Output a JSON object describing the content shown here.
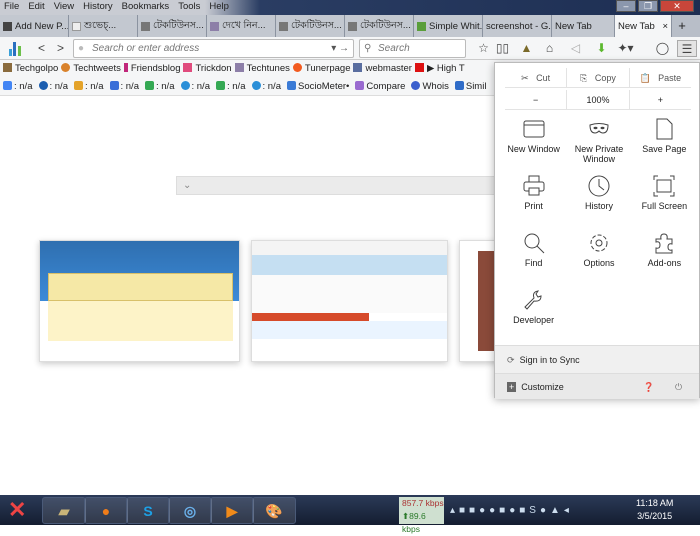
{
  "menubar": [
    "File",
    "Edit",
    "View",
    "History",
    "Bookmarks",
    "Tools",
    "Help"
  ],
  "tabs": [
    "Add New P...",
    "শুভেচ্...",
    "টেকটিউনস...",
    "দেখে নিন...",
    "টেকটিউনস...",
    "টেকটিউনস...",
    "Simple Whit...",
    "screenshot - G...",
    "New Tab",
    "New Tab"
  ],
  "nav": {
    "url_placeholder": "Search or enter address",
    "search_placeholder": "Search"
  },
  "bookmarks": [
    {
      "label": "Techgolpo",
      "color": "#8a6b3d"
    },
    {
      "label": "Techtweets",
      "color": "#d9822b"
    },
    {
      "label": "Friendsblog",
      "color": "#c0267a"
    },
    {
      "label": "Trickdon",
      "color": "#e04b7d"
    },
    {
      "label": "Techtunes",
      "color": "#8d7fa8"
    },
    {
      "label": "Tunerpage",
      "color": "#f25a1f"
    },
    {
      "label": "webmaster",
      "color": "#5a6ea0"
    },
    {
      "label": "▶ High T",
      "color": "#d11"
    }
  ],
  "addons": [
    {
      "label": ": n/a",
      "color": "#4285f4"
    },
    {
      "label": ": n/a",
      "color": "#1b5eb0"
    },
    {
      "label": ": n/a",
      "color": "#e4a32a"
    },
    {
      "label": ": n/a",
      "color": "#3a6fd8"
    },
    {
      "label": ": n/a",
      "color": "#34a853"
    },
    {
      "label": ": n/a",
      "color": "#2a8fd8"
    },
    {
      "label": ": n/a",
      "color": "#34a853"
    },
    {
      "label": ": n/a",
      "color": "#2a8fd8"
    },
    {
      "label": "SocioMeter•",
      "color": "#3b7bd6"
    },
    {
      "label": "Compare",
      "color": "#9a6bd0"
    },
    {
      "label": "Whois",
      "color": "#3a5fcd"
    },
    {
      "label": "Simil",
      "color": "#2f6cc8"
    }
  ],
  "panel": {
    "cut": "Cut",
    "copy": "Copy",
    "paste": "Paste",
    "zoom_out": "−",
    "zoom": "100%",
    "zoom_in": "+",
    "items": [
      "New Window",
      "New Private Window",
      "Save Page",
      "Print",
      "History",
      "Full Screen",
      "Find",
      "Options",
      "Add-ons",
      "Developer"
    ],
    "sync": "Sign in to Sync",
    "customize": "Customize"
  },
  "taskbar": {
    "down": "857.7 kbps",
    "up": "⬆89.6 kbps",
    "time": "11:18 AM",
    "date": "3/5/2015"
  }
}
